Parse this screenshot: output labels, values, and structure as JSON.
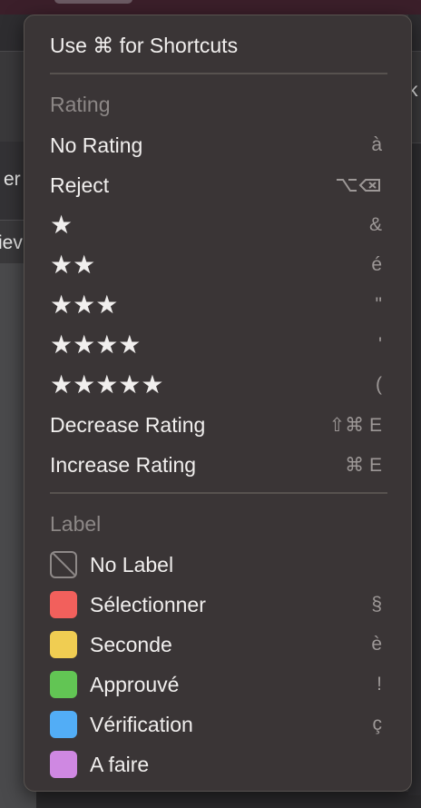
{
  "backdrop": {
    "left_fragments": [
      "er",
      "iev"
    ],
    "right_fragment": "k"
  },
  "menu": {
    "top_item": {
      "label": "Use ⌘ for Shortcuts"
    },
    "rating_section": {
      "header": "Rating",
      "items": [
        {
          "label": "No Rating",
          "shortcut": "à"
        },
        {
          "label": "Reject",
          "shortcut": "⌥⌫"
        },
        {
          "label": "★",
          "shortcut": "&",
          "stars": 1
        },
        {
          "label": "★★",
          "shortcut": "é",
          "stars": 2
        },
        {
          "label": "★★★",
          "shortcut": "\"",
          "stars": 3
        },
        {
          "label": "★★★★",
          "shortcut": "'",
          "stars": 4
        },
        {
          "label": "★★★★★",
          "shortcut": "(",
          "stars": 5
        },
        {
          "label": "Decrease Rating",
          "shortcut": "⇧⌘ E"
        },
        {
          "label": "Increase Rating",
          "shortcut": "⌘ E"
        }
      ]
    },
    "label_section": {
      "header": "Label",
      "items": [
        {
          "label": "No Label",
          "shortcut": "",
          "color": "none",
          "icon": "no-label-icon"
        },
        {
          "label": "Sélectionner",
          "shortcut": "§",
          "color": "#f2605c"
        },
        {
          "label": "Seconde",
          "shortcut": "è",
          "color": "#f0cd52"
        },
        {
          "label": "Approuvé",
          "shortcut": "!",
          "color": "#62c554"
        },
        {
          "label": "Vérification",
          "shortcut": "ç",
          "color": "#52adf6"
        },
        {
          "label": "A faire",
          "shortcut": "",
          "color": "#cf88e2"
        }
      ]
    }
  }
}
